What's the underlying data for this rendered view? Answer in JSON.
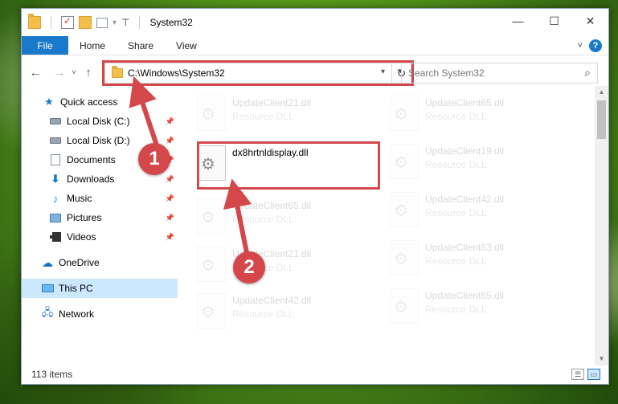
{
  "window": {
    "title": "System32",
    "controls": {
      "minimize": "—",
      "maximize": "☐",
      "close": "✕"
    }
  },
  "ribbon": {
    "tabs": [
      "File",
      "Home",
      "Share",
      "View"
    ],
    "expand_icon": "chevron-down-icon",
    "help": "?"
  },
  "nav": {
    "back": "←",
    "forward": "→",
    "recent": "˅",
    "up": "↑",
    "address": "C:\\Windows\\System32",
    "refresh": "↻",
    "search_placeholder": "Search System32",
    "search_icon": "⌕"
  },
  "sidebar": {
    "items": [
      {
        "label": "Quick access",
        "icon": "star-icon",
        "pinned": false
      },
      {
        "label": "Local Disk (C:)",
        "icon": "disk-icon",
        "pinned": true
      },
      {
        "label": "Local Disk (D:)",
        "icon": "disk-icon",
        "pinned": true
      },
      {
        "label": "Documents",
        "icon": "documents-icon",
        "pinned": true
      },
      {
        "label": "Downloads",
        "icon": "downloads-icon",
        "pinned": true
      },
      {
        "label": "Music",
        "icon": "music-icon",
        "pinned": true
      },
      {
        "label": "Pictures",
        "icon": "pictures-icon",
        "pinned": true
      },
      {
        "label": "Videos",
        "icon": "videos-icon",
        "pinned": true
      },
      {
        "label": "OneDrive",
        "icon": "cloud-icon",
        "pinned": false
      },
      {
        "label": "This PC",
        "icon": "computer-icon",
        "pinned": false,
        "selected": true
      },
      {
        "label": "Network",
        "icon": "network-icon",
        "pinned": false
      }
    ]
  },
  "files": {
    "highlighted": {
      "name": "dx8hrtnldisplay.dll"
    },
    "left_column": [
      {
        "name": "UpdateClient21.dll",
        "type": "Resource DLL"
      },
      {
        "name": "UpdateClient65.dll",
        "type": "Resource DLL"
      },
      {
        "name": "UpdateClient21.dll",
        "type": "Resource DLL"
      },
      {
        "name": "UpdateClient42.dll",
        "type": "Resource DLL"
      }
    ],
    "right_column": [
      {
        "name": "UpdateClient65.dll",
        "type": "Resource DLL"
      },
      {
        "name": "UpdateClient19.dll",
        "type": "Resource DLL"
      },
      {
        "name": "UpdateClient42.dll",
        "type": "Resource DLL"
      },
      {
        "name": "UpdateClient63.dll",
        "type": "Resource DLL"
      },
      {
        "name": "UpdateClient65.dll",
        "type": "Resource DLL"
      }
    ]
  },
  "status": {
    "item_count": "113 items"
  },
  "callouts": {
    "one": "1",
    "two": "2"
  },
  "colors": {
    "accent": "#1979ca",
    "highlight": "#d4484c",
    "selected": "#cce8ff"
  }
}
